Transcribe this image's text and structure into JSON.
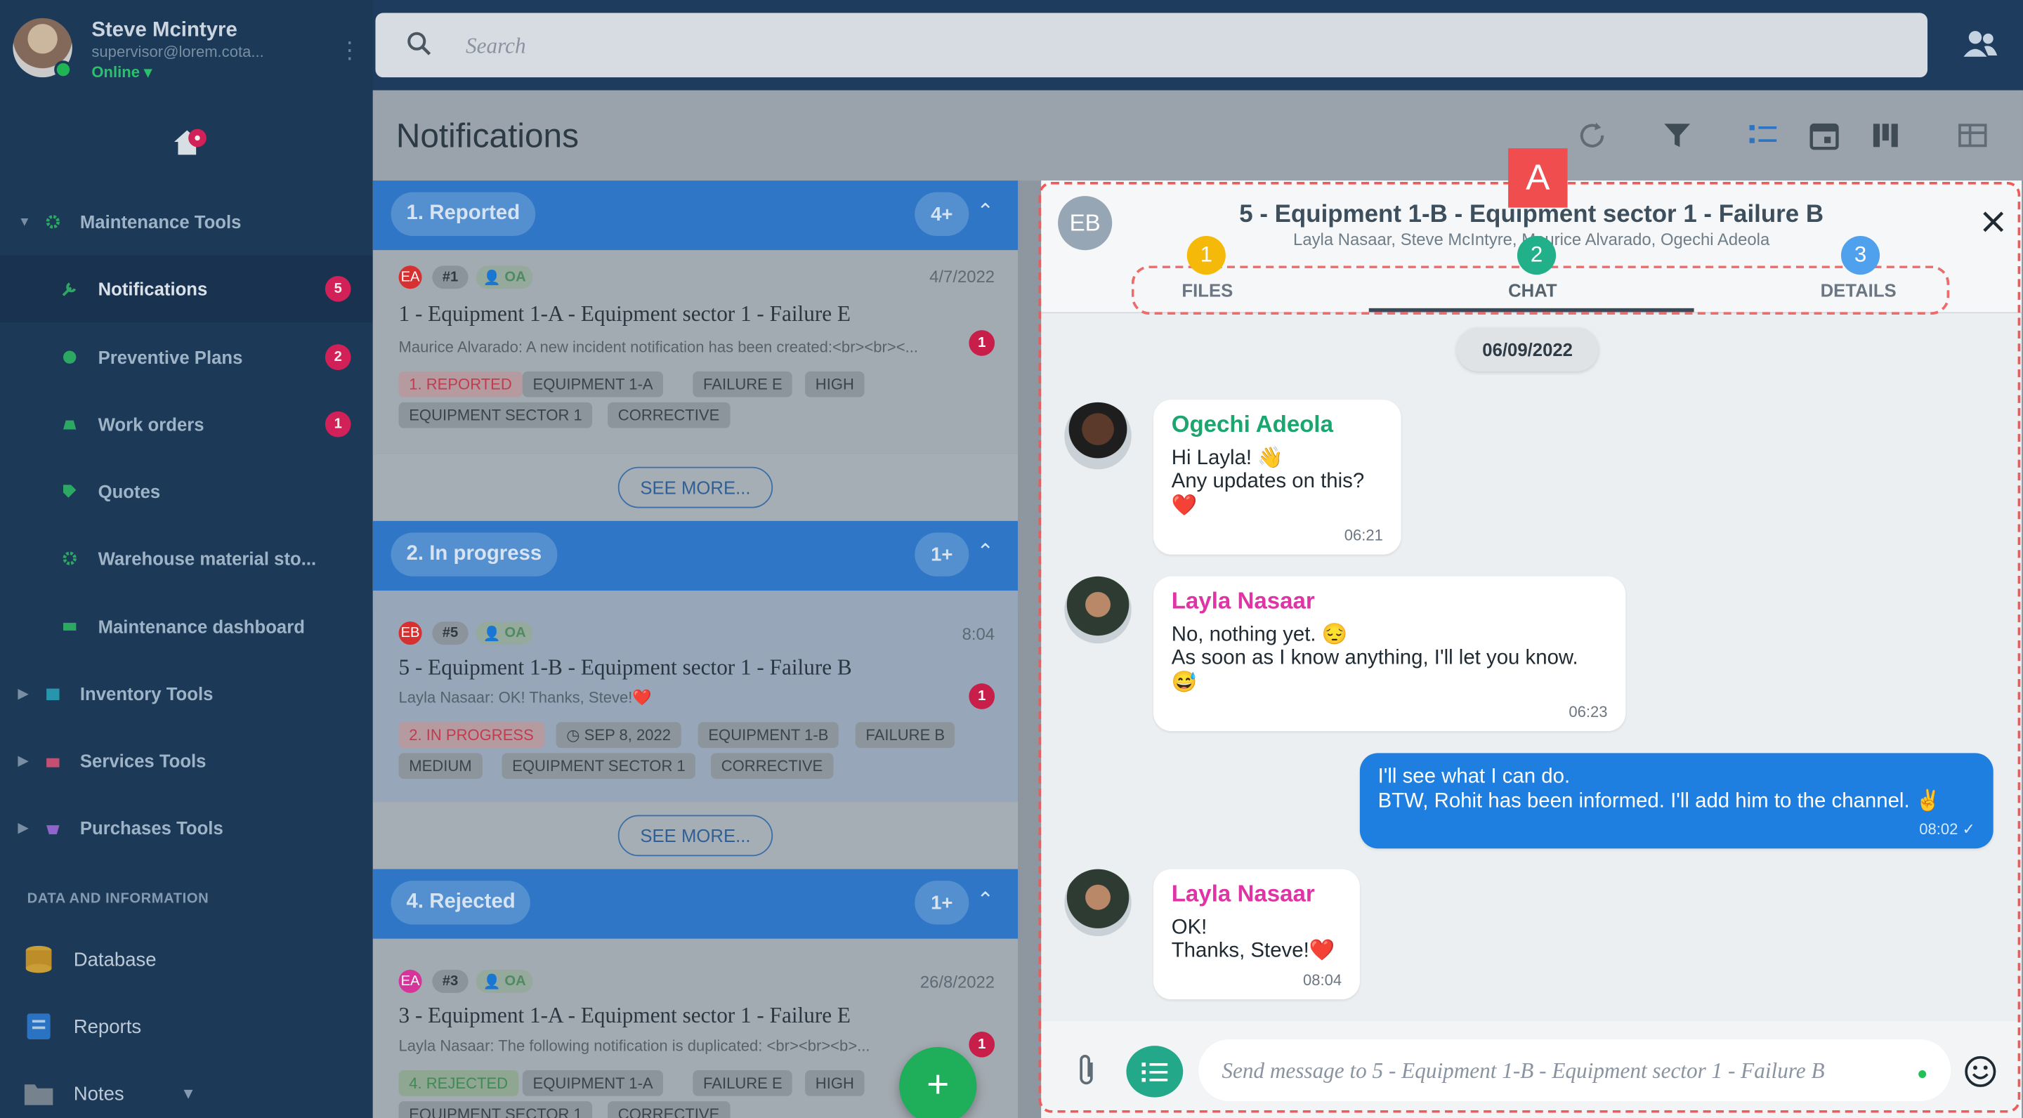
{
  "user": {
    "name": "Steve Mcintyre",
    "email": "supervisor@lorem.cota...",
    "status": "Online"
  },
  "sidebar": {
    "group_maintenance": "Maintenance Tools",
    "items": [
      {
        "label": "Notifications",
        "badge": "5"
      },
      {
        "label": "Preventive Plans",
        "badge": "2"
      },
      {
        "label": "Work orders",
        "badge": "1"
      },
      {
        "label": "Quotes",
        "badge": ""
      },
      {
        "label": "Warehouse material sto...",
        "badge": ""
      },
      {
        "label": "Maintenance dashboard",
        "badge": ""
      }
    ],
    "groups": [
      "Inventory Tools",
      "Services Tools",
      "Purchases Tools"
    ],
    "section_title": "DATA AND INFORMATION",
    "data_items": [
      "Database",
      "Reports",
      "Notes"
    ],
    "colors": {
      "bg": "#1e3d5e",
      "badge": "#e0245e",
      "online": "#23c05a"
    }
  },
  "search": {
    "placeholder": "Search"
  },
  "page": {
    "title": "Notifications"
  },
  "groups": [
    {
      "label": "1. Reported",
      "count": "4+"
    },
    {
      "label": "2. In progress",
      "count": "1+"
    },
    {
      "label": "4. Rejected",
      "count": "1+"
    }
  ],
  "cards": [
    {
      "avatar": "EA",
      "num": "#1",
      "assignee": "OA",
      "date": "4/7/2022",
      "title": "1 - Equipment 1-A - Equipment sector 1 - Failure E",
      "desc": "Maurice Alvarado: A new incident notification has been created:<br><br><...",
      "count": "1",
      "tags": [
        "1. REPORTED",
        "EQUIPMENT 1-A",
        "FAILURE E",
        "HIGH",
        "EQUIPMENT SECTOR 1",
        "CORRECTIVE"
      ]
    },
    {
      "avatar": "EB",
      "num": "#5",
      "assignee": "OA",
      "date": "8:04",
      "title": "5 - Equipment 1-B - Equipment sector 1 - Failure B",
      "desc": "Layla Nasaar: OK! Thanks, Steve!❤️",
      "count": "1",
      "tags": [
        "2. IN PROGRESS",
        "SEP 8, 2022",
        "EQUIPMENT 1-B",
        "FAILURE B",
        "MEDIUM",
        "EQUIPMENT SECTOR 1",
        "CORRECTIVE"
      ]
    },
    {
      "avatar": "EA",
      "num": "#3",
      "assignee": "OA",
      "date": "26/8/2022",
      "title": "3 - Equipment 1-A - Equipment sector 1 - Failure E",
      "desc": "Layla Nasaar: The following notification is duplicated: <br><br><b>...",
      "count": "1",
      "tags": [
        "4. REJECTED",
        "EQUIPMENT 1-A",
        "FAILURE E",
        "HIGH",
        "EQUIPMENT SECTOR 1",
        "CORRECTIVE"
      ]
    }
  ],
  "see_more": "SEE MORE...",
  "fab": "+",
  "chat": {
    "avatar": "EB",
    "title": "5 - Equipment 1-B - Equipment sector 1 - Failure B",
    "participants": "Layla Nasaar, Steve McIntyre, Maurice Alvarado, Ogechi Adeola",
    "tabs": [
      "FILES",
      "CHAT",
      "DETAILS"
    ],
    "date": "06/09/2022",
    "messages": [
      {
        "from": "Ogechi Adeola",
        "lines": [
          "Hi Layla! 👋",
          "Any updates on this?",
          "❤️"
        ],
        "time": "06:21"
      },
      {
        "from": "Layla Nasaar",
        "lines": [
          "No, nothing yet. 😔",
          "As soon as I know anything, I'll let you know.",
          "😅"
        ],
        "time": "06:23"
      },
      {
        "from": "",
        "lines": [
          "I'll see what I can do.",
          "BTW, Rohit has been informed. I'll add him to the channel. ✌️"
        ],
        "time": "08:02 ✓"
      },
      {
        "from": "Layla Nasaar",
        "lines": [
          "OK!",
          "Thanks, Steve!❤️"
        ],
        "time": "08:04"
      }
    ],
    "input_placeholder": "Send message to 5 - Equipment 1-B - Equipment sector 1 - Failure B",
    "colors": {
      "outgoing": "#1e7fe0",
      "ogechi": "#1aa66e",
      "layla": "#e034a6"
    }
  },
  "annotations": {
    "A": "A",
    "steps": [
      "1",
      "2",
      "3"
    ]
  }
}
